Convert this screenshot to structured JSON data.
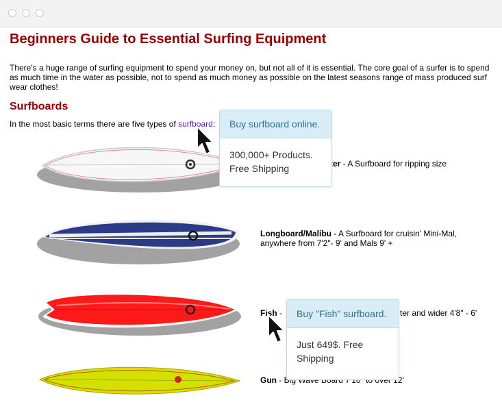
{
  "page": {
    "title": "Beginners Guide to Essential Surfing Equipment",
    "intro": "There's a huge range of surfing equipment to spend your money on, but not all of it is essential.   The core goal of a surfer is to spend as much time in the water as possible, not to spend as much money as possible on the latest seasons range of mass produced surf wear clothes!",
    "section_heading": "Surfboards",
    "types_prefix": "In the most basic terms there are five types of ",
    "types_link": "surfboard",
    "types_suffix": ":"
  },
  "boards": [
    {
      "name": "Shortboard/Thruster",
      "name_visible": "ter",
      "description": " - A Surfboard for ripping size",
      "description_line2": ""
    },
    {
      "name": "Longboard/Malibu",
      "description": " - A Surfboard for cruisin' Mini-Mal,",
      "description_line2": "anywhere from 7'2\"- 9' and Mals 9' +"
    },
    {
      "name": "Fish",
      "description": " - ",
      "description_tail": "ter and wider 4'8\" - 6'"
    },
    {
      "name": "Gun",
      "description": " - Big Wave Board 7'10\" to over 12'"
    }
  ],
  "tooltips": [
    {
      "header": "Buy surfboard online.",
      "body": "300,000+ Products. Free Shipping"
    },
    {
      "header": "Buy \"Fish\" surfboard.",
      "body": "Just 649$. Free Shipping"
    }
  ],
  "colors": {
    "heading": "#990000",
    "link": "#5a1fc7",
    "tooltip_header_bg": "#d9edf7",
    "tooltip_header_text": "#31708f",
    "board_longboard": "#2b3b86",
    "board_fish": "#ff1a1a",
    "board_gun": "#d4e000"
  },
  "icons": [
    "window-close-dot",
    "window-minimize-dot",
    "window-maximize-dot",
    "mouse-pointer-icon"
  ]
}
